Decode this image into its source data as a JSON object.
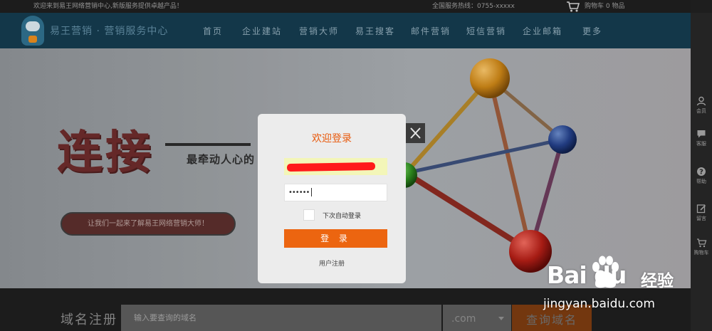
{
  "topbar": {
    "welcome": "欢迎来到易王网络营销中心,新版服务提供卓越产品！",
    "hotline": "全国服务热线：0755-xxxxx",
    "cart": "购物车 0 物品"
  },
  "nav": {
    "logo_text": "易王营销 · 营销服务中心",
    "items": [
      {
        "label": "首页"
      },
      {
        "label": "企业建站"
      },
      {
        "label": "营销大师"
      },
      {
        "label": "易王搜客"
      },
      {
        "label": "邮件营销"
      },
      {
        "label": "短信营销"
      },
      {
        "label": "企业邮箱"
      },
      {
        "label": "更多"
      }
    ]
  },
  "hero": {
    "title": "连接",
    "subtitle": "最牵动人心的",
    "cta": "让我们一起来了解易王网络营销大师！"
  },
  "domain": {
    "label": "域名注册",
    "placeholder": "输入要查询的域名",
    "suffix": ".com",
    "button": "查询域名"
  },
  "sidebar": {
    "items": [
      {
        "label": "会员",
        "icon": "user-icon"
      },
      {
        "label": "客服",
        "icon": "chat-icon"
      },
      {
        "label": "帮助",
        "icon": "help-icon"
      },
      {
        "label": "留言",
        "icon": "edit-icon"
      },
      {
        "label": "购物车",
        "icon": "cart-icon"
      }
    ]
  },
  "modal": {
    "title": "欢迎登录",
    "password_mask": "••••••",
    "remember": "下次自动登录",
    "login": "登 录",
    "register": "用户注册"
  },
  "watermark": {
    "logo": "Bai  du",
    "product": "经验",
    "url": "jingyan.baidu.com"
  },
  "colors": {
    "accent": "#ec6510",
    "title": "#e8590c",
    "nav_bg": "#153a4d"
  }
}
